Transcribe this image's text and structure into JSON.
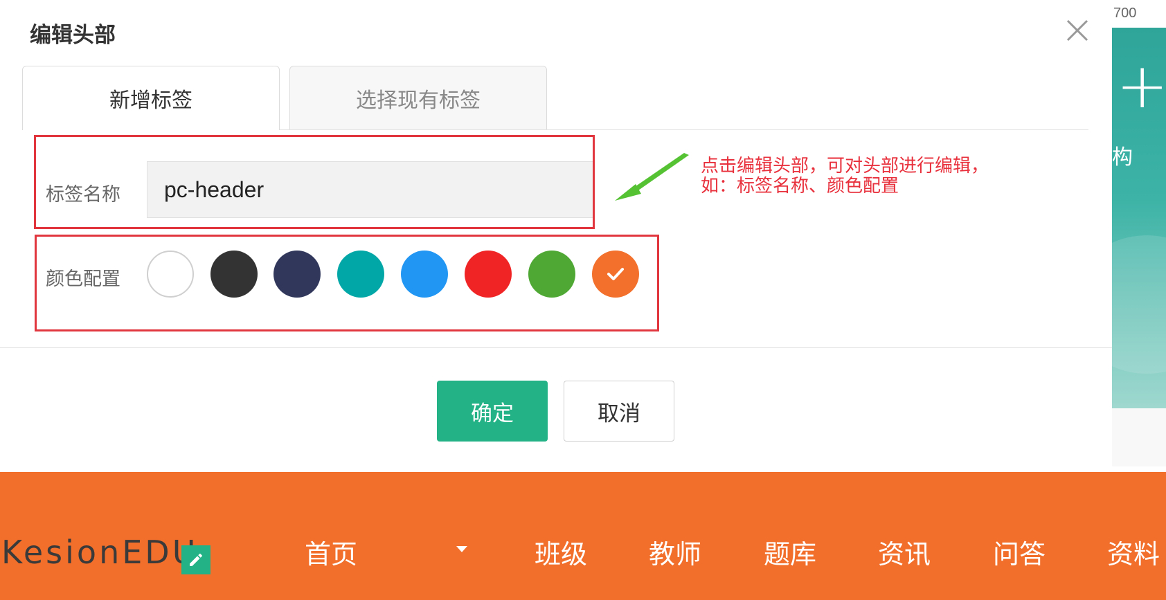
{
  "modal": {
    "title": "编辑头部",
    "tabs": [
      {
        "label": "新增标签",
        "active": true
      },
      {
        "label": "选择现有标签",
        "active": false
      }
    ],
    "tag_name_label": "标签名称",
    "tag_name_value": "pc-header",
    "color_label": "颜色配置",
    "colors": [
      {
        "name": "white",
        "hex": "#ffffff",
        "selected": false
      },
      {
        "name": "dark-gray",
        "hex": "#333333",
        "selected": false
      },
      {
        "name": "navy",
        "hex": "#30375b",
        "selected": false
      },
      {
        "name": "teal",
        "hex": "#00a7a6",
        "selected": false
      },
      {
        "name": "blue",
        "hex": "#2196f3",
        "selected": false
      },
      {
        "name": "red",
        "hex": "#f02424",
        "selected": false
      },
      {
        "name": "green",
        "hex": "#4ea833",
        "selected": false
      },
      {
        "name": "orange",
        "hex": "#f2702b",
        "selected": true
      }
    ],
    "confirm_label": "确定",
    "cancel_label": "取消"
  },
  "annotation": {
    "line1": "点击编辑头部，可对头部进行编辑，",
    "line2": "如：标签名称、颜色配置"
  },
  "background": {
    "ruler_value": "700",
    "banner_char": "构",
    "logo": "KesionEDU",
    "nav": [
      "首页",
      "班级",
      "教师",
      "题库",
      "资讯",
      "问答",
      "资料"
    ]
  },
  "colors": {
    "accent": "#22b285",
    "header_orange": "#f26f2b",
    "annotation_red": "#e2363f",
    "arrow_green": "#55c233"
  }
}
